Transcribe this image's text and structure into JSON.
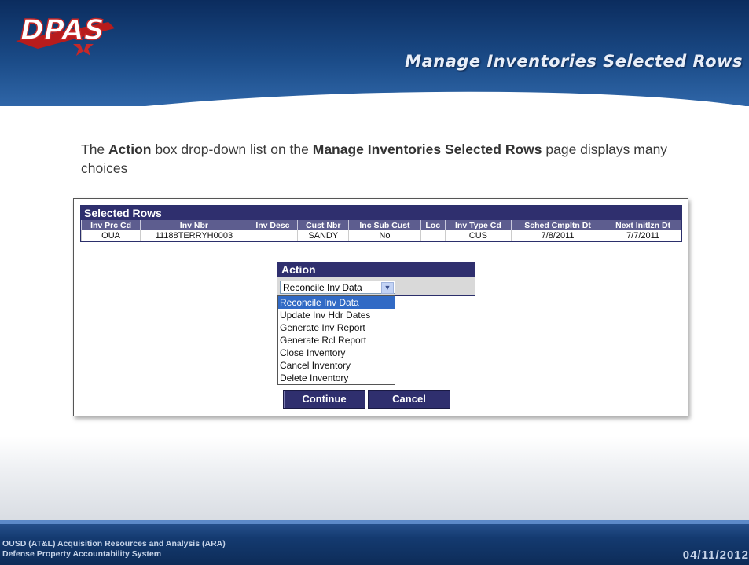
{
  "slide": {
    "logo_text": "DPAS",
    "title": "Manage Inventories Selected Rows",
    "intro": {
      "p1": "The ",
      "b1": "Action",
      "p2": " box drop-down list on the ",
      "b2": "Manage Inventories Selected Rows",
      "p3": " page displays many choices"
    }
  },
  "selected_rows": {
    "title": "Selected Rows",
    "columns": [
      "Inv Prc Cd",
      "Inv Nbr",
      "Inv Desc",
      "Cust Nbr",
      "Inc Sub Cust",
      "Loc",
      "Inv Type Cd",
      "Sched Cmpltn Dt",
      "Next Initlzn Dt"
    ],
    "row": [
      "OUA",
      "11188TERRYH0003",
      "",
      "SANDY",
      "No",
      "",
      "CUS",
      "7/8/2011",
      "7/7/2011"
    ]
  },
  "action": {
    "title": "Action",
    "selected": "Reconcile Inv Data",
    "options": [
      "Reconcile Inv Data",
      "Update Inv Hdr Dates",
      "Generate Inv Report",
      "Generate Rcl Report",
      "Close Inventory",
      "Cancel Inventory",
      "Delete Inventory"
    ]
  },
  "buttons": {
    "continue": "Continue",
    "cancel": "Cancel"
  },
  "footer": {
    "line1": "OUSD (AT&L) Acquisition Resources and Analysis (ARA)",
    "line2": "Defense Property Accountability System",
    "date": "04/11/2012"
  },
  "colors": {
    "header_blue": "#1a4a86",
    "panel_navy": "#2f2f6e",
    "highlight": "#316ac5"
  }
}
